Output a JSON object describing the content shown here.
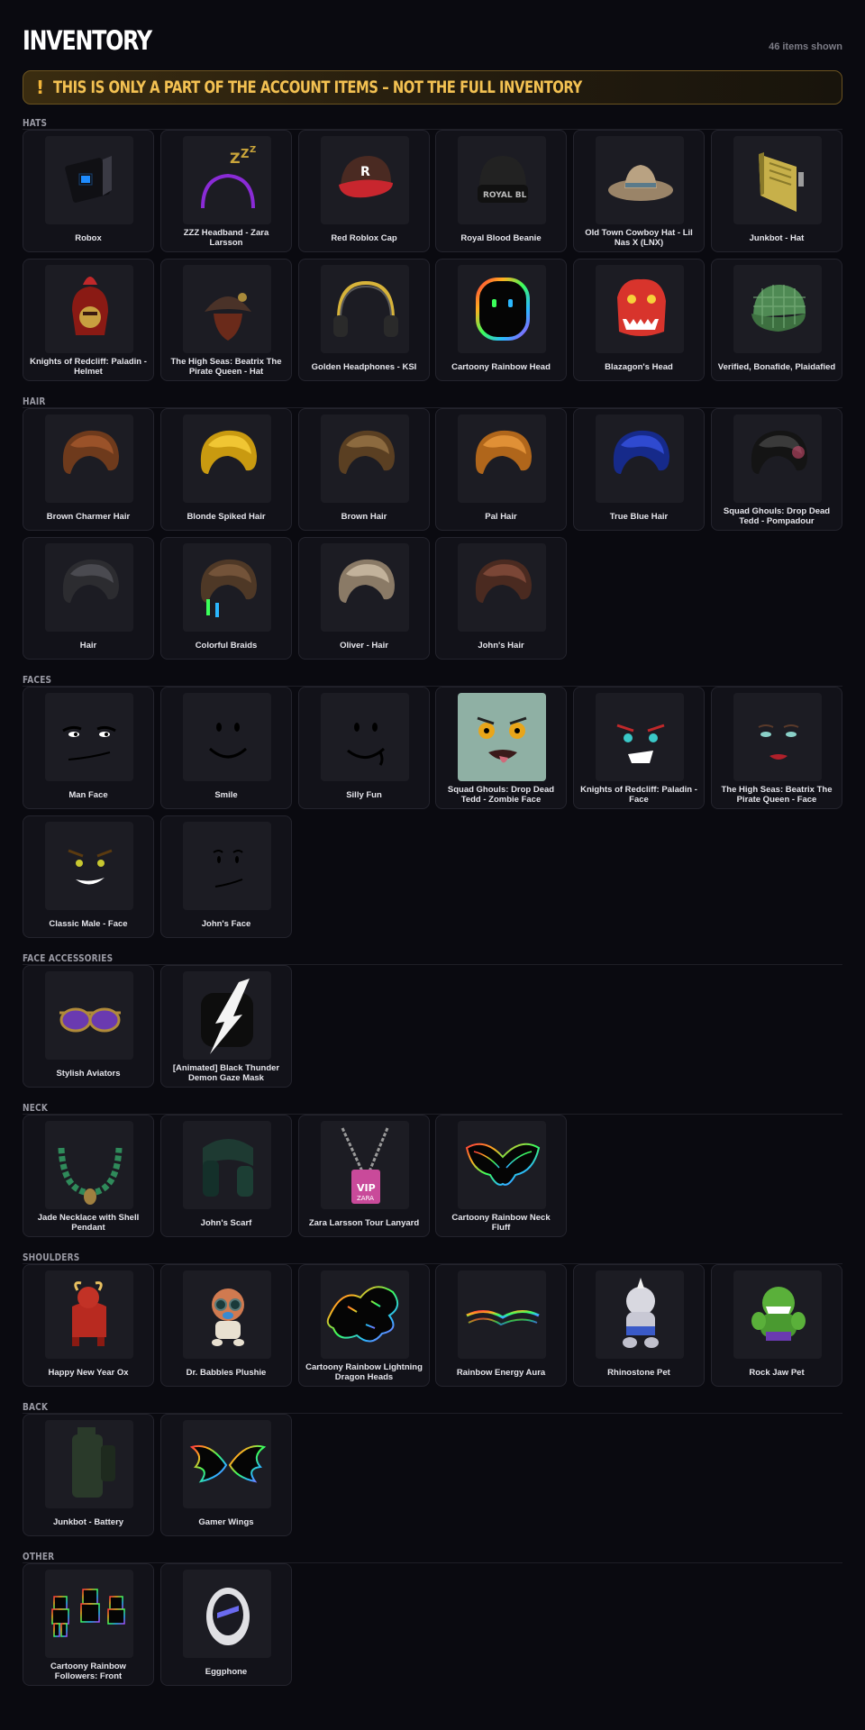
{
  "header": {
    "title": "INVENTORY",
    "count": "46 items shown"
  },
  "warning": {
    "icon": "exclamation-icon",
    "glyph": "!",
    "text": "THIS IS ONLY A PART OF THE ACCOUNT ITEMS – NOT THE FULL INVENTORY"
  },
  "colors": {
    "background": "#0a0a10",
    "card": "#121219",
    "thumb": "#1c1c23",
    "accent": "#f3c152"
  },
  "sections": [
    {
      "title": "HATS",
      "items": [
        {
          "name": "Robox",
          "icon": "robox-icon"
        },
        {
          "name": "ZZZ Headband - Zara Larsson",
          "icon": "zzz-headband-icon"
        },
        {
          "name": "Red Roblox Cap",
          "icon": "red-cap-icon"
        },
        {
          "name": "Royal Blood Beanie",
          "icon": "beanie-icon"
        },
        {
          "name": "Old Town Cowboy Hat - Lil Nas X (LNX)",
          "icon": "cowboy-hat-icon"
        },
        {
          "name": "Junkbot - Hat",
          "icon": "junkbot-hat-icon"
        },
        {
          "name": "Knights of Redcliff: Paladin - Helmet",
          "icon": "paladin-helmet-icon"
        },
        {
          "name": "The High Seas: Beatrix The Pirate Queen - Hat",
          "icon": "pirate-hat-icon"
        },
        {
          "name": "Golden Headphones - KSI",
          "icon": "headphones-icon"
        },
        {
          "name": "Cartoony Rainbow Head",
          "icon": "rainbow-head-icon"
        },
        {
          "name": "Blazagon's Head",
          "icon": "dragon-head-icon"
        },
        {
          "name": "Verified, Bonafide, Plaidafied",
          "icon": "plaid-cap-icon"
        }
      ]
    },
    {
      "title": "HAIR",
      "items": [
        {
          "name": "Brown Charmer Hair",
          "icon": "hair-icon"
        },
        {
          "name": "Blonde Spiked Hair",
          "icon": "hair-icon"
        },
        {
          "name": "Brown Hair",
          "icon": "hair-icon"
        },
        {
          "name": "Pal Hair",
          "icon": "hair-icon"
        },
        {
          "name": "True Blue Hair",
          "icon": "hair-icon"
        },
        {
          "name": "Squad Ghouls: Drop Dead Tedd - Pompadour",
          "icon": "hair-icon"
        },
        {
          "name": "Hair",
          "icon": "hair-icon"
        },
        {
          "name": "Colorful Braids",
          "icon": "hair-icon"
        },
        {
          "name": "Oliver - Hair",
          "icon": "hair-icon"
        },
        {
          "name": "John's Hair",
          "icon": "hair-icon"
        }
      ]
    },
    {
      "title": "FACES",
      "items": [
        {
          "name": "Man Face",
          "icon": "face-icon"
        },
        {
          "name": "Smile",
          "icon": "face-icon"
        },
        {
          "name": "Silly Fun",
          "icon": "face-icon"
        },
        {
          "name": "Squad Ghouls: Drop Dead Tedd - Zombie Face",
          "icon": "zombie-face-icon"
        },
        {
          "name": "Knights of Redcliff: Paladin - Face",
          "icon": "face-icon"
        },
        {
          "name": "The High Seas: Beatrix The Pirate Queen - Face",
          "icon": "face-icon"
        },
        {
          "name": "Classic Male - Face",
          "icon": "face-icon"
        },
        {
          "name": "John's Face",
          "icon": "face-icon"
        }
      ]
    },
    {
      "title": "FACE ACCESSORIES",
      "items": [
        {
          "name": "Stylish Aviators",
          "icon": "aviators-icon"
        },
        {
          "name": "[Animated] Black Thunder Demon Gaze Mask",
          "icon": "mask-icon"
        }
      ]
    },
    {
      "title": "NECK",
      "items": [
        {
          "name": "Jade Necklace with Shell Pendant",
          "icon": "necklace-icon"
        },
        {
          "name": "John's Scarf",
          "icon": "scarf-icon"
        },
        {
          "name": "Zara Larsson Tour Lanyard",
          "icon": "lanyard-icon",
          "badge_top": "VIP",
          "badge_bottom": "ZARA"
        },
        {
          "name": "Cartoony Rainbow Neck Fluff",
          "icon": "neck-fluff-icon"
        }
      ]
    },
    {
      "title": "SHOULDERS",
      "items": [
        {
          "name": "Happy New Year Ox",
          "icon": "ox-icon"
        },
        {
          "name": "Dr. Babbles Plushie",
          "icon": "plushie-icon"
        },
        {
          "name": "Cartoony Rainbow Lightning Dragon Heads",
          "icon": "dragon-heads-icon"
        },
        {
          "name": "Rainbow Energy Aura",
          "icon": "aura-icon"
        },
        {
          "name": "Rhinostone Pet",
          "icon": "rhino-pet-icon"
        },
        {
          "name": "Rock Jaw Pet",
          "icon": "rock-jaw-pet-icon"
        }
      ]
    },
    {
      "title": "BACK",
      "items": [
        {
          "name": "Junkbot - Battery",
          "icon": "battery-icon"
        },
        {
          "name": "Gamer Wings",
          "icon": "wings-icon"
        }
      ]
    },
    {
      "title": "OTHER",
      "items": [
        {
          "name": "Cartoony Rainbow Followers: Front",
          "icon": "followers-icon"
        },
        {
          "name": "Eggphone",
          "icon": "eggphone-icon"
        }
      ]
    }
  ]
}
